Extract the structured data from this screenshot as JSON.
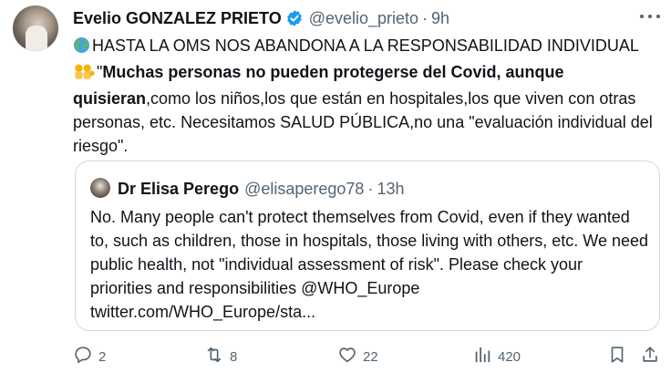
{
  "tweet": {
    "author_name": "Evelio GONZALEZ PRIETO",
    "handle": "@evelio_prieto",
    "separator": "·",
    "time": "9h",
    "line1_text": "HASTA LA OMS NOS ABANDONA A LA RESPONSABILIDAD INDIVIDUAL",
    "quote_open": "\"",
    "bold_text": "Muchas personas no pueden protegerse del Covid, aunque quisieran",
    "rest_text": ",como los niños,los que están en hospitales,los que viven con otras personas, etc. Necesitamos SALUD PÚBLICA,no una \"evaluación individual del riesgo\"."
  },
  "quoted": {
    "author_name": "Dr Elisa Perego",
    "handle": "@elisaperego78",
    "separator": "·",
    "time": "13h",
    "text": "No. Many people can't protect themselves from Covid, even if they wanted to, such as children, those in hospitals, those living with others, etc. We need public health, not \"individual assessment of risk\". Please check your priorities and responsibilities @WHO_Europe twitter.com/WHO_Europe/sta..."
  },
  "actions": {
    "replies": "2",
    "retweets": "8",
    "likes": "22",
    "views": "420"
  },
  "colors": {
    "verified": "#1d9bf0",
    "muted": "#536471",
    "border": "#cfd9de"
  },
  "icons": [
    "verified-badge-icon",
    "more-icon",
    "globe-icon",
    "family-icon",
    "reply-icon",
    "retweet-icon",
    "like-icon",
    "views-icon",
    "bookmark-icon",
    "share-icon"
  ]
}
